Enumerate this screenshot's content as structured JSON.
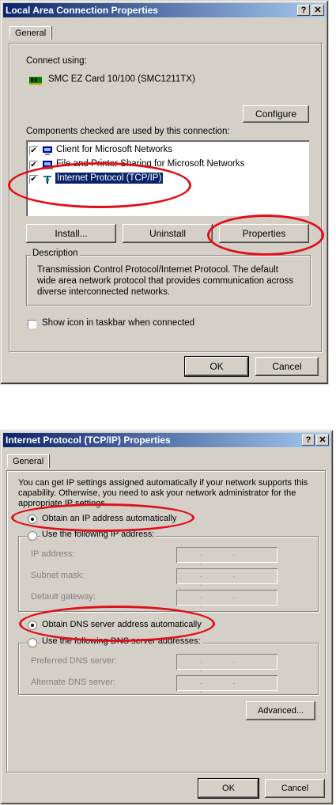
{
  "dialog1": {
    "title": "Local Area Connection Properties",
    "help_btn": "?",
    "close_btn": "✕",
    "tab": "General",
    "connect_using_label": "Connect using:",
    "adapter": "SMC EZ Card 10/100 (SMC1211TX)",
    "configure_btn": "Configure",
    "components_label": "Components checked are used by this connection:",
    "components": [
      {
        "label": "Client for Microsoft Networks",
        "checked": true,
        "icon": "network-client-icon"
      },
      {
        "label": "File and Printer Sharing for Microsoft Networks",
        "checked": true,
        "icon": "file-printer-sharing-icon"
      },
      {
        "label": "Internet Protocol (TCP/IP)",
        "checked": true,
        "icon": "protocol-icon",
        "selected": true
      }
    ],
    "install_btn": "Install...",
    "uninstall_btn": "Uninstall",
    "properties_btn": "Properties",
    "description_legend": "Description",
    "description_text": "Transmission Control Protocol/Internet Protocol. The default wide area network protocol that provides communication across diverse interconnected networks.",
    "show_icon_label": "Show icon in taskbar when connected",
    "show_icon_checked": false,
    "ok_btn": "OK",
    "cancel_btn": "Cancel"
  },
  "dialog2": {
    "title": "Internet Protocol (TCP/IP) Properties",
    "help_btn": "?",
    "close_btn": "✕",
    "tab": "General",
    "intro": "You can get IP settings assigned automatically if your network supports this capability. Otherwise, you need to ask your network administrator for the appropriate IP settings.",
    "obtain_ip_auto": "Obtain an IP address automatically",
    "use_following_ip": "Use the following IP address:",
    "ip_address_label": "IP address:",
    "subnet_label": "Subnet mask:",
    "gateway_label": "Default gateway:",
    "obtain_dns_auto": "Obtain DNS server address automatically",
    "use_following_dns": "Use the following DNS server addresses:",
    "preferred_dns_label": "Preferred DNS server:",
    "alternate_dns_label": "Alternate DNS server:",
    "ip_dots": ". . .",
    "advanced_btn": "Advanced...",
    "ok_btn": "OK",
    "cancel_btn": "Cancel"
  },
  "colors": {
    "title_start": "#0a246a",
    "title_end": "#a6caf0",
    "highlight": "#0a246a",
    "annotation_red": "#e0101a",
    "face": "#d4d0c8"
  }
}
